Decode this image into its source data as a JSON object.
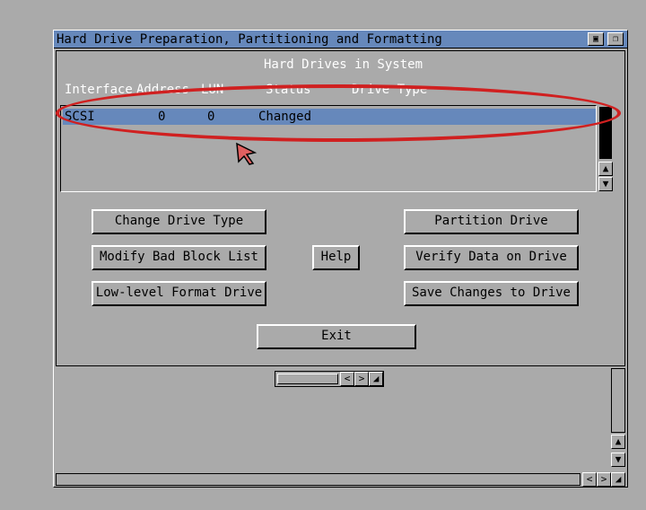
{
  "window": {
    "title": "Hard Drive Preparation, Partitioning and Formatting",
    "gadgets": [
      "depth-gadget",
      "zoom-gadget"
    ]
  },
  "section_heading": "Hard Drives in System",
  "columns": [
    "Interface",
    "Address",
    "LUN",
    "Status",
    "Drive Type"
  ],
  "drives": [
    {
      "interface": "SCSI",
      "address": "0",
      "lun": "0",
      "status": "Changed",
      "drive_type": ""
    }
  ],
  "buttons": {
    "change_drive_type": "Change Drive Type",
    "modify_bad_block": "Modify Bad Block List",
    "low_level_format": "Low-level Format Drive",
    "help": "Help",
    "partition_drive": "Partition Drive",
    "verify_data": "Verify Data on Drive",
    "save_changes": "Save Changes to Drive",
    "exit": "Exit"
  },
  "icons": {
    "scroll_up": "▲",
    "scroll_down": "▼",
    "scroll_left": "<",
    "scroll_right": ">"
  },
  "colors": {
    "background": "#aaaaaa",
    "titlebar": "#6688bb",
    "selection": "#6688bb",
    "annotation": "#d02020"
  }
}
